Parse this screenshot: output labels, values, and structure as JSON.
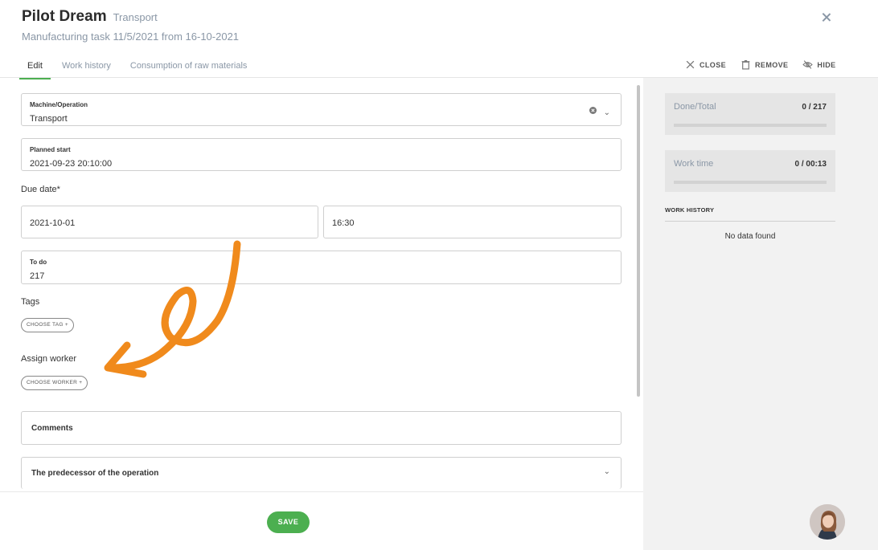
{
  "header": {
    "title": "Pilot Dream",
    "title_sub": "Transport",
    "subtitle": "Manufacturing task 11/5/2021 from 16-10-2021"
  },
  "tabs": [
    {
      "label": "Edit",
      "active": true
    },
    {
      "label": "Work history",
      "active": false
    },
    {
      "label": "Consumption of raw materials",
      "active": false
    }
  ],
  "actions": {
    "close": "CLOSE",
    "remove": "REMOVE",
    "hide": "HIDE"
  },
  "form": {
    "machine": {
      "label": "Machine/Operation",
      "value": "Transport"
    },
    "planned_start": {
      "label": "Planned start",
      "value": "2021-09-23 20:10:00"
    },
    "due_date": {
      "label": "Due date*",
      "date": "2021-10-01",
      "time": "16:30"
    },
    "todo": {
      "label": "To do",
      "value": "217"
    },
    "tags": {
      "label": "Tags",
      "button": "CHOOSE TAG +"
    },
    "worker": {
      "label": "Assign worker",
      "button": "CHOOSE WORKER +"
    },
    "comments": {
      "label": "Comments"
    },
    "predecessor": {
      "label": "The predecessor of the operation"
    }
  },
  "save_label": "SAVE",
  "stats": {
    "done_total": {
      "label": "Done/Total",
      "value": "0 / 217",
      "progress": 0
    },
    "work_time": {
      "label": "Work time",
      "value": "0 / 00:13",
      "progress": 0
    }
  },
  "work_history": {
    "title": "WORK HISTORY",
    "empty": "No data found"
  },
  "colors": {
    "accent": "#4caf50",
    "annotation_arrow": "#f08a1c"
  }
}
